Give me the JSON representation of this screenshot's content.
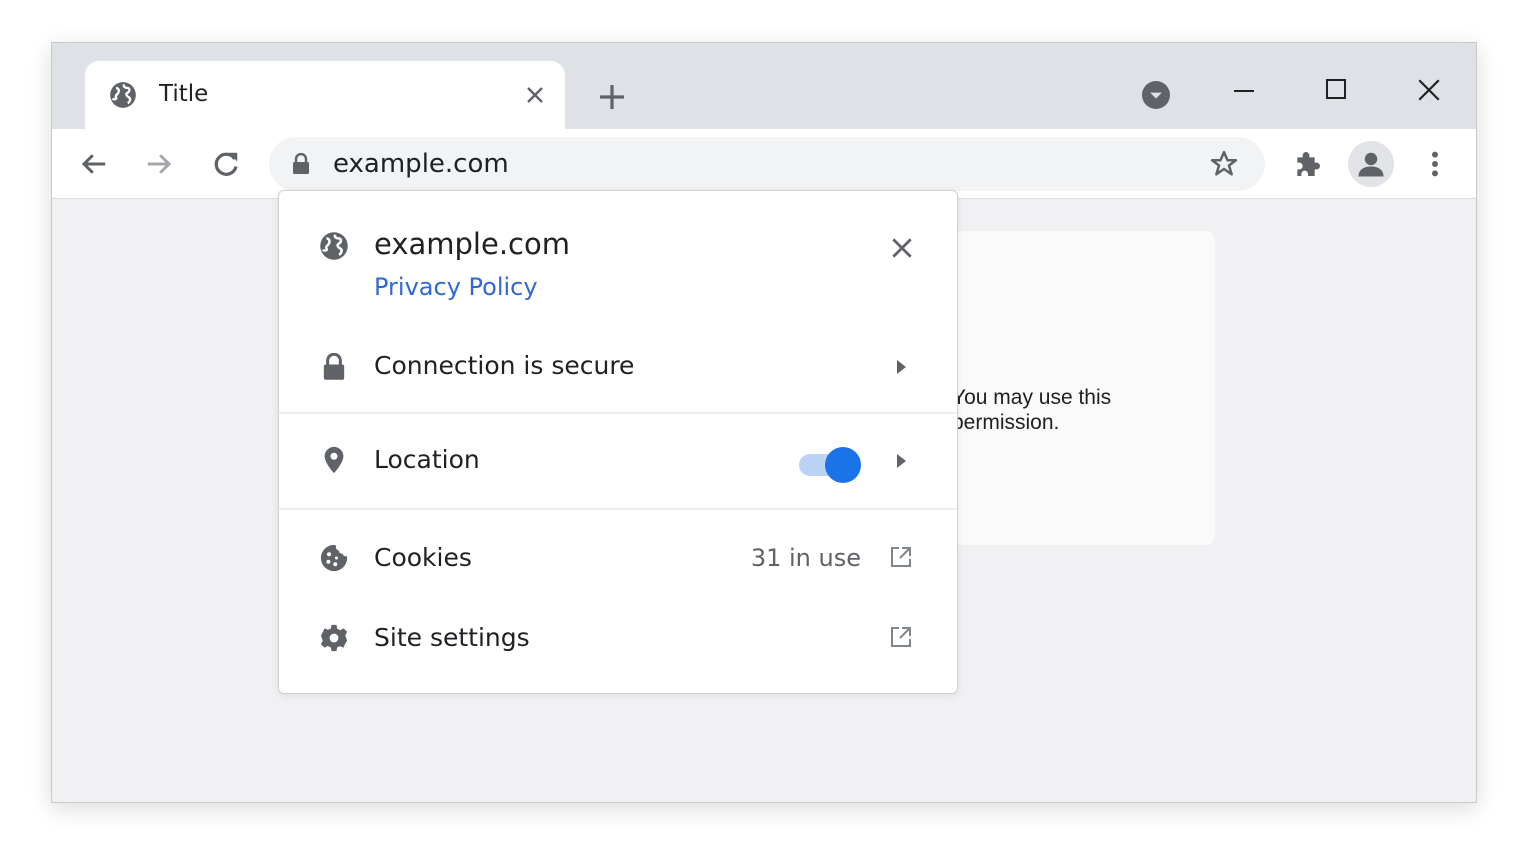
{
  "browser": {
    "tab": {
      "title": "Title",
      "icon": "globe-icon"
    },
    "new_tab_icon": "plus-icon",
    "tab_search_icon": "chevron-circle-icon",
    "window_controls": [
      "minimize-icon",
      "maximize-icon",
      "close-icon"
    ]
  },
  "toolbar": {
    "back_icon": "arrow-left-icon",
    "forward_icon": "arrow-right-icon",
    "reload_icon": "reload-icon",
    "omnibox": {
      "url": "example.com",
      "security_icon": "lock-icon",
      "bookmark_icon": "star-icon"
    },
    "extensions_icon": "puzzle-icon",
    "profile_icon": "person-icon",
    "menu_icon": "more-vertical-icon"
  },
  "page": {
    "card_text": "You may use this permission."
  },
  "site_info": {
    "site_name": "example.com",
    "privacy_link": "Privacy Policy",
    "connection_label": "Connection is secure",
    "location_label": "Location",
    "location_enabled": true,
    "cookies_label": "Cookies",
    "cookies_count": "31 in use",
    "site_settings_label": "Site settings"
  },
  "colors": {
    "accent": "#1a73e8",
    "link": "#3367d6",
    "tabstrip": "#dee1e6",
    "icon": "#5f6368"
  }
}
